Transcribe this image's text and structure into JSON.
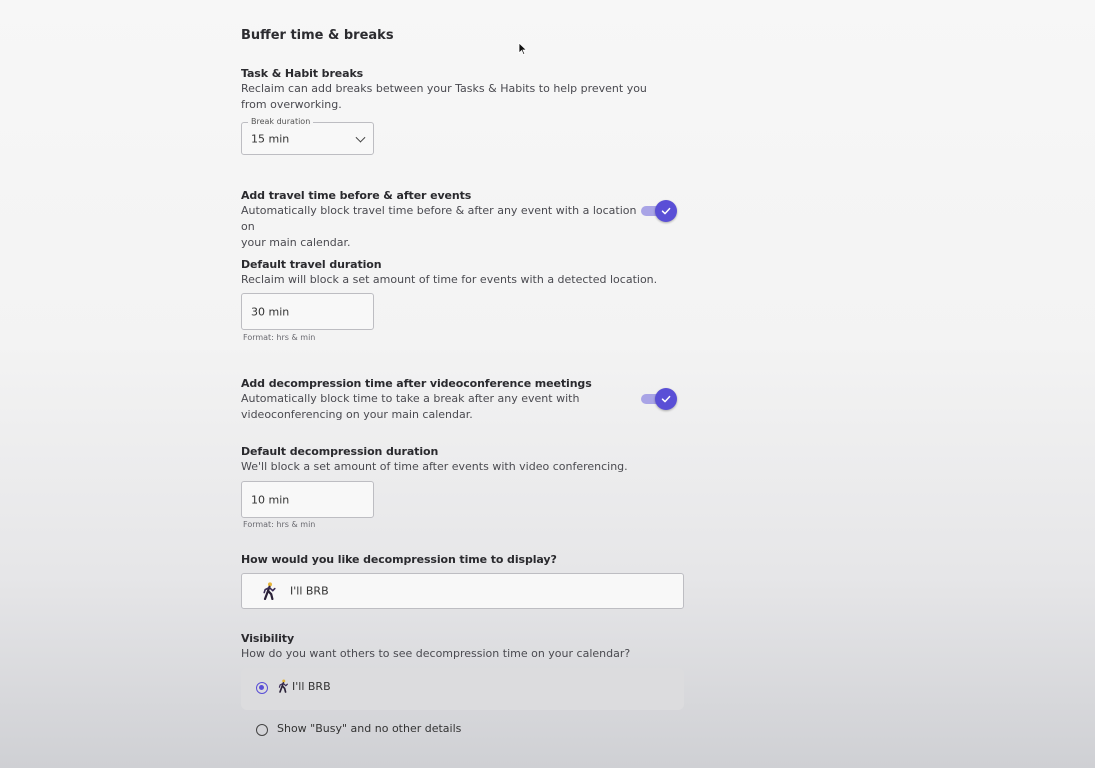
{
  "section_title": "Buffer time & breaks",
  "task_breaks": {
    "label": "Task & Habit breaks",
    "desc_line1": "Reclaim can add breaks between your Tasks & Habits to help prevent you",
    "desc_line2": "from overworking.",
    "field_legend": "Break duration",
    "field_value": "15 min"
  },
  "travel_time": {
    "label": "Add travel time before & after events",
    "desc_line1": "Automatically block travel time before & after any event with a location on",
    "desc_line2": "your main calendar.",
    "enabled": true
  },
  "default_travel": {
    "label": "Default travel duration",
    "desc": "Reclaim will block a set amount of time for events with a detected location.",
    "field_value": "30 min",
    "helper": "Format: hrs & min"
  },
  "decompression": {
    "label": "Add decompression time after videoconference meetings",
    "desc_line1": "Automatically block time to take a break after any event with",
    "desc_line2": "videoconferencing on your main calendar.",
    "enabled": true
  },
  "default_decompression": {
    "label": "Default decompression duration",
    "desc": "We'll block a set amount of time after events with video conferencing.",
    "field_value": "10 min",
    "helper": "Format: hrs & min"
  },
  "display": {
    "label": "How would you like decompression time to display?",
    "value": "I'll BRB",
    "icon": "person-walking-icon"
  },
  "visibility": {
    "label": "Visibility",
    "desc": "How do you want others to see decompression time on your calendar?",
    "options": [
      {
        "label": "I'll BRB",
        "selected": true
      },
      {
        "label": "Show \"Busy\" and no other details",
        "selected": false
      }
    ]
  },
  "colors": {
    "accent": "#5a4fd6",
    "accent_light": "#a9a4e6"
  }
}
